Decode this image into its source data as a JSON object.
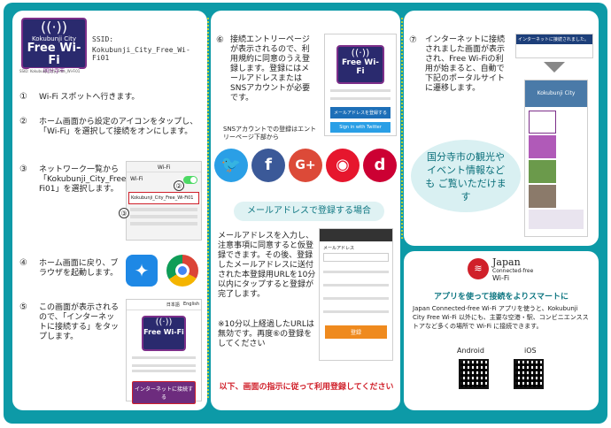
{
  "left": {
    "logo": {
      "brand": "Kokubunji City",
      "title": "Free Wi-Fi",
      "sub": "SSID: Kokubunji_City_Free_Wi-Fi01",
      "tag": "国分寺市"
    },
    "ssid_label": "SSID:",
    "ssid_value": "Kokubunji_City_Free_Wi-Fi01",
    "steps": [
      {
        "num": "①",
        "text": "Wi-Fi スポットへ行きます。"
      },
      {
        "num": "②",
        "text": "ホーム画面から設定のアイコンをタップし、「Wi-Fi」を選択して接続をオンにします。"
      },
      {
        "num": "③",
        "text": "ネットワーク一覧から「Kokubunji_City_Free_Wi-Fi01」を選択します。"
      },
      {
        "num": "④",
        "text": "ホーム画面に戻り、ブラウザを起動します。"
      },
      {
        "num": "⑤",
        "text": "この画面が表示されるので、「インターネットに接続する」をタップします。"
      }
    ],
    "phone3": {
      "title": "Wi-Fi",
      "row_wifi": "Wi-Fi",
      "network": "Kokubunji_City_Free_Wi-Fi01",
      "mark2": "②",
      "mark3": "③"
    },
    "phone5": {
      "tabs": [
        "日本語",
        "English"
      ],
      "button": "インターネットに接続する"
    }
  },
  "middle": {
    "step6_num": "⑥",
    "step6_text": "接続エントリーページが表示されるので、利用規約に同意のうえ登録します。登録にはメールアドレスまたはSNSアカウントが必要です。",
    "sns_note": "SNSアカウントでの登録はエントリーページ下部から",
    "phone6": {
      "email_btn": "メールアドレスを登録する",
      "twitter_btn": "Sign in with Twitter"
    },
    "sns": [
      {
        "name": "twitter",
        "glyph": "🐦",
        "color": "#2a9fe6"
      },
      {
        "name": "facebook",
        "glyph": "f",
        "color": "#3b5998"
      },
      {
        "name": "google-plus",
        "glyph": "G+",
        "color": "#dc4a38"
      },
      {
        "name": "weibo",
        "glyph": "◉",
        "color": "#e6162d"
      },
      {
        "name": "docomo",
        "glyph": "d",
        "color": "#cc0033"
      }
    ],
    "banner": "メールアドレスで登録する場合",
    "email_text": "メールアドレスを入力し、注意事項に同意すると仮登録できます。その後、登録したメールアドレスに送付された本登録用URLを10分以内にタップすると登録が完了します。",
    "email_note": "※10分以上経過したURLは無効です。再度⑥の登録をしてください",
    "footer": "以下、画面の指示に従って利用登録してください",
    "phone7": {
      "field": "メールアドレス",
      "btn": "登録"
    }
  },
  "right": {
    "step7_num": "⑦",
    "step7_text": "インターネットに接続されました画面が表示され、Free Wi-Fiの利用が始まると、自動で下記のポータルサイトに遷移します。",
    "connected_label": "インターネットに接続されました。",
    "portal_title": "Kokubunji City",
    "bubble": "国分寺市の観光やイベント情報なども ご覧いただけます"
  },
  "japan": {
    "logo_top": "Japan",
    "logo_sub": "Connected-free",
    "logo_wifi": "Wi-Fi",
    "headline": "アプリを使って接続をよりスマートに",
    "body": "Japan Connected-free Wi-Fi アプリを使うと、Kokubunji City Free Wi-Fi 以外にも、主要な空港・駅、コンビニエンスストアなど多くの場所で Wi-Fi に接続できます。",
    "android": "Android",
    "ios": "iOS"
  },
  "colors": {
    "teal": "#0d9aa7",
    "purple": "#7d2f8a",
    "navy": "#2a2a6e",
    "red": "#d0202a"
  }
}
